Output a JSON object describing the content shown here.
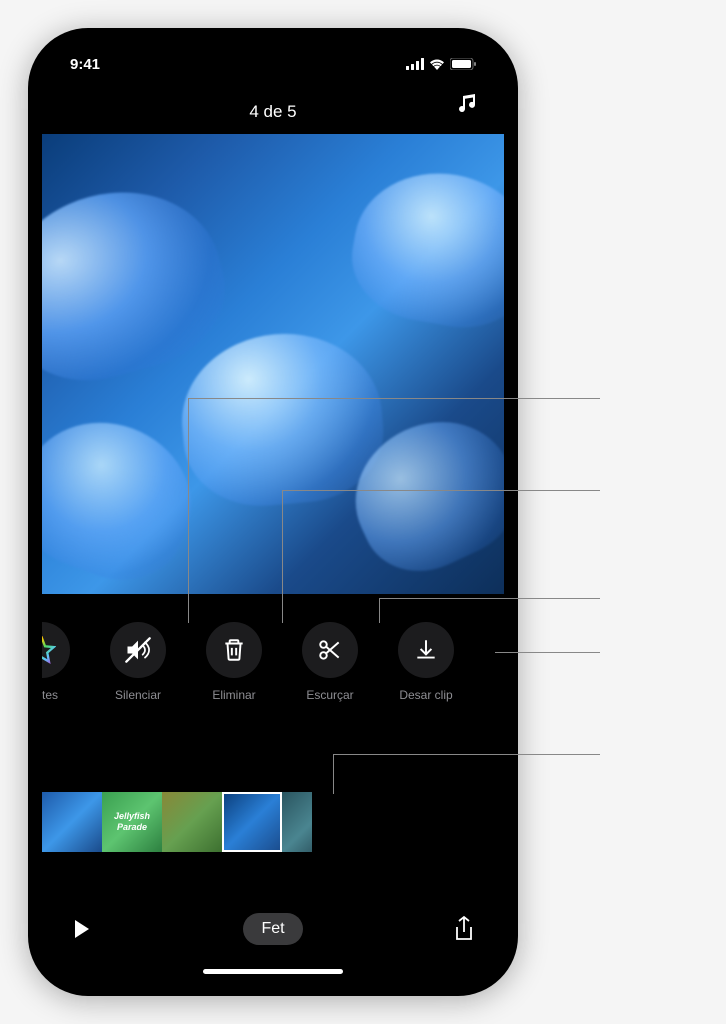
{
  "status": {
    "time": "9:41"
  },
  "header": {
    "title": "4 de 5"
  },
  "toolbar": {
    "effects_label": "fectes",
    "mute_label": "Silenciar",
    "delete_label": "Eliminar",
    "trim_label": "Escurçar",
    "save_label": "Desar clip"
  },
  "thumbnails": {
    "text_clip": "Jellyfish Parade"
  },
  "bottom": {
    "done_label": "Fet"
  }
}
